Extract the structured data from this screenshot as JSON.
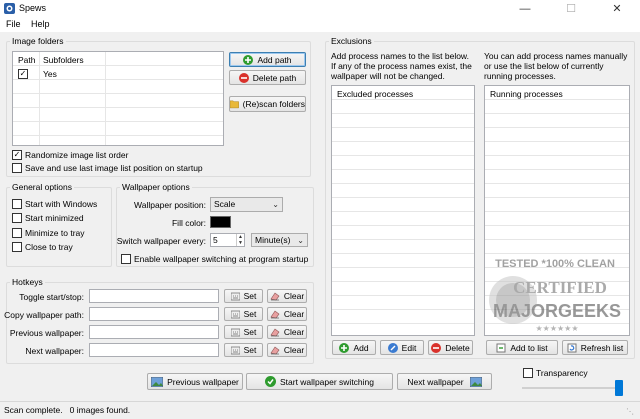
{
  "window": {
    "title": "Spews"
  },
  "menu": [
    "File",
    "Help"
  ],
  "image_folders": {
    "title": "Image folders",
    "columns": [
      "Path",
      "Subfolders"
    ],
    "rows": [
      {
        "path_checked": true,
        "subfolders": "Yes"
      }
    ],
    "add_path": "Add path",
    "delete_path": "Delete path",
    "rescan": "(Re)scan folders",
    "randomize": {
      "label": "Randomize image list order",
      "checked": true
    },
    "save_position": {
      "label": "Save and use last image list position on startup",
      "checked": false
    }
  },
  "general_options": {
    "title": "General options",
    "items": [
      {
        "label": "Start with Windows",
        "checked": false
      },
      {
        "label": "Start minimized",
        "checked": false
      },
      {
        "label": "Minimize to tray",
        "checked": false
      },
      {
        "label": "Close to tray",
        "checked": false
      }
    ]
  },
  "wallpaper_options": {
    "title": "Wallpaper options",
    "position_label": "Wallpaper position:",
    "position_value": "Scale",
    "fill_color_label": "Fill color:",
    "fill_color": "#000000",
    "switch_every_label": "Switch wallpaper every:",
    "switch_every_value": "5",
    "switch_unit": "Minute(s)",
    "enable_at_startup": {
      "label": "Enable wallpaper switching at program startup",
      "checked": false
    }
  },
  "hotkeys": {
    "title": "Hotkeys",
    "rows": [
      {
        "label": "Toggle start/stop:"
      },
      {
        "label": "Copy wallpaper path:"
      },
      {
        "label": "Previous wallpaper:"
      },
      {
        "label": "Next wallpaper:"
      }
    ],
    "set_label": "Set",
    "clear_label": "Clear"
  },
  "exclusions": {
    "title": "Exclusions",
    "left_desc": "Add process names to the list below.  If any of the process names exist, the wallpaper will not be changed.",
    "right_desc": "You can add process names manually or use the list below of currently running processes.",
    "excluded_header": "Excluded processes",
    "running_header": "Running processes",
    "add": "Add",
    "edit": "Edit",
    "delete": "Delete",
    "add_to_list": "Add to list",
    "refresh_list": "Refresh list"
  },
  "watermark": {
    "line1": "TESTED *100% CLEAN",
    "line2": "CERTIFIED",
    "line3": "MAJORGEEKS",
    "stars": "★★★★★★"
  },
  "bottom": {
    "previous": "Previous wallpaper",
    "start": "Start wallpaper switching",
    "next": "Next wallpaper",
    "transparency": {
      "label": "Transparency",
      "checked": false
    }
  },
  "status": "Scan complete.   0 images found.",
  "colors": {
    "accent": "#0078d7",
    "add_green": "#2e9b2e",
    "delete_red": "#d9312b"
  }
}
